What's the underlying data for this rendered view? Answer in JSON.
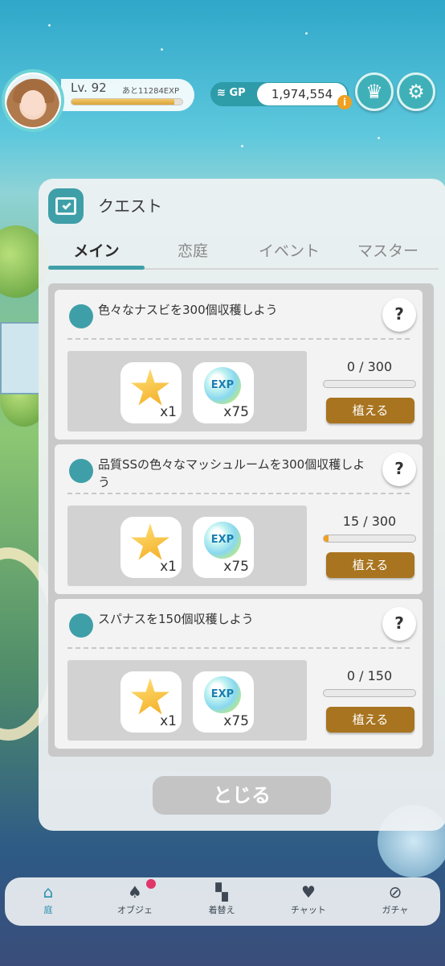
{
  "header": {
    "level_label": "Lv. 92",
    "exp_remaining": "あと11284EXP",
    "exp_progress": 0.93,
    "gp_label": "GP",
    "gp_value": "1,974,554",
    "gp_info": "i"
  },
  "quest": {
    "title": "クエスト",
    "tabs": [
      {
        "label": "メイン",
        "active": true
      },
      {
        "label": "恋庭",
        "active": false
      },
      {
        "label": "イベント",
        "active": false
      },
      {
        "label": "マスター",
        "active": false
      }
    ],
    "items": [
      {
        "title": "色々なナスビを300個収穫しよう",
        "rewards": [
          {
            "icon": "star-icon",
            "qty": "x1"
          },
          {
            "icon": "exp-orb-icon",
            "label": "EXP",
            "qty": "x75"
          }
        ],
        "progress_text": "0 / 300",
        "progress": 0.0,
        "button": "植える"
      },
      {
        "title": "品質SSの色々なマッシュルームを300個収穫しよう",
        "rewards": [
          {
            "icon": "star-icon",
            "qty": "x1"
          },
          {
            "icon": "exp-orb-icon",
            "label": "EXP",
            "qty": "x75"
          }
        ],
        "progress_text": "15 / 300",
        "progress": 0.05,
        "button": "植える"
      },
      {
        "title": "スパナスを150個収穫しよう",
        "rewards": [
          {
            "icon": "star-icon",
            "qty": "x1"
          },
          {
            "icon": "exp-orb-icon",
            "label": "EXP",
            "qty": "x75"
          }
        ],
        "progress_text": "0 / 150",
        "progress": 0.0,
        "button": "植える"
      }
    ],
    "close_label": "とじる"
  },
  "nav": {
    "items": [
      {
        "label": "庭",
        "icon": "house-icon",
        "active": true
      },
      {
        "label": "オブジェ",
        "icon": "object-icon",
        "badge": true
      },
      {
        "label": "着替え",
        "icon": "clothes-icon"
      },
      {
        "label": "チャット",
        "icon": "chat-icon"
      },
      {
        "label": "ガチャ",
        "icon": "gacha-icon"
      }
    ]
  },
  "colors": {
    "accent": "#3f9fa8",
    "button_brown": "#a8741f",
    "progress_orange": "#f0a020",
    "badge_red": "#e0366a"
  }
}
